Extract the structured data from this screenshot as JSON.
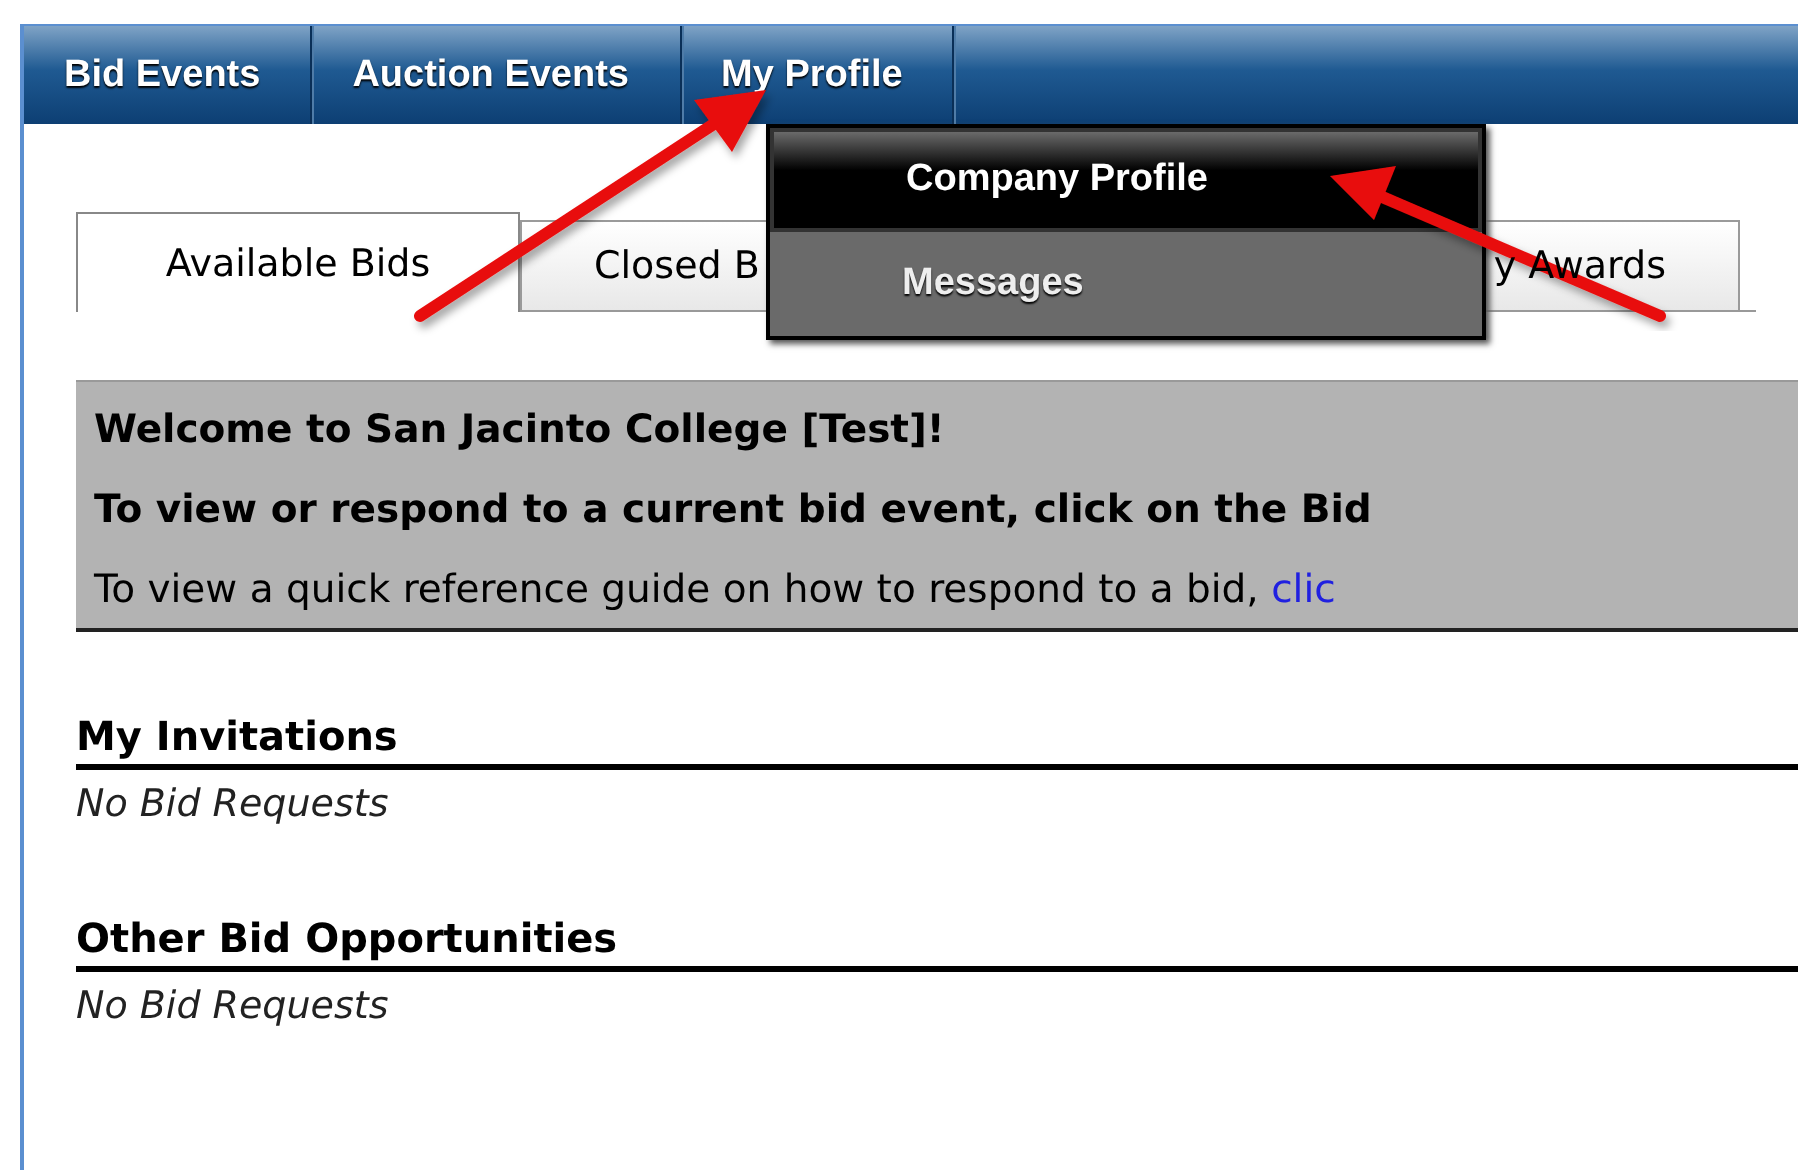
{
  "nav": [
    {
      "label": "Bid Events"
    },
    {
      "label": "Auction Events"
    },
    {
      "label": "My Profile"
    }
  ],
  "dropdown": [
    {
      "label": "Company Profile",
      "selected": true
    },
    {
      "label": "Messages",
      "selected": false
    }
  ],
  "tabs": [
    {
      "label": "Available Bids",
      "selected": true
    },
    {
      "label": "Closed B",
      "selected": false
    },
    {
      "label": "y Awards",
      "selected": false
    }
  ],
  "welcome": {
    "title": "Welcome to San Jacinto College [Test]!",
    "instruction": "To view or respond to a current bid event, click on the Bid",
    "guide_text": "To view a quick reference guide on how to respond to a bid,",
    "guide_link": "clic"
  },
  "sections": [
    {
      "heading": "My Invitations",
      "empty_text": "No Bid Requests"
    },
    {
      "heading": "Other Bid Opportunities",
      "empty_text": "No Bid Requests"
    }
  ]
}
